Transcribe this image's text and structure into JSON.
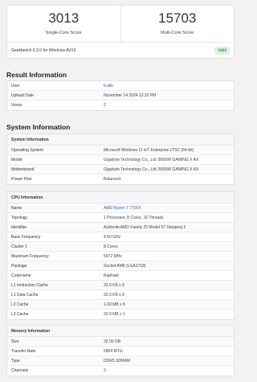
{
  "scores": {
    "single_core": {
      "value": "3013",
      "label": "Single-Core Score"
    },
    "multi_core": {
      "value": "15703",
      "label": "Multi-Core Score"
    },
    "version": "Geekbench 6.3.0 for Windows AVX2",
    "status": "Valid"
  },
  "result_information": {
    "title": "Result Information",
    "rows": [
      {
        "key": "User",
        "value": "Exillic"
      },
      {
        "key": "Upload Date",
        "value": "November 14 2024 12:10 PM"
      },
      {
        "key": "Views",
        "value": "2"
      }
    ]
  },
  "system_information": {
    "title": "System Information",
    "system": {
      "heading": "System Information",
      "rows": [
        {
          "key": "Operating System",
          "value": "Microsoft Windows 11 IoT Enterprise LTSC (64-bit)"
        },
        {
          "key": "Model",
          "value": "Gigabyte Technology Co., Ltd. B650M GAMING X AX"
        },
        {
          "key": "Motherboard",
          "value": "Gigabyte Technology Co., Ltd. B650M GAMING X AX"
        },
        {
          "key": "Power Plan",
          "value": "Balanced"
        }
      ]
    },
    "cpu": {
      "heading": "CPU Information",
      "rows": [
        {
          "key": "Name",
          "value": "AMD Ryzen 7 7700X"
        },
        {
          "key": "Topology",
          "value": "1 Processor, 8 Cores, 16 Threads"
        },
        {
          "key": "Identifier",
          "value": "AuthenticAMD Family 25 Model 97 Stepping 2"
        },
        {
          "key": "Base Frequency",
          "value": "4.50 GHz"
        },
        {
          "key": "Cluster 1",
          "value": "8 Cores"
        },
        {
          "key": "Maximum Frequency",
          "value": "5472 MHz"
        },
        {
          "key": "Package",
          "value": "Socket AM5 (LGA1718)"
        },
        {
          "key": "Codename",
          "value": "Raphael"
        },
        {
          "key": "L1 Instruction Cache",
          "value": "32.0 KB x 8"
        },
        {
          "key": "L1 Data Cache",
          "value": "32.0 KB x 8"
        },
        {
          "key": "L2 Cache",
          "value": "1.00 MB x 8"
        },
        {
          "key": "L3 Cache",
          "value": "32.0 MB x 1"
        }
      ]
    },
    "memory": {
      "heading": "Memory Information",
      "rows": [
        {
          "key": "Size",
          "value": "32.00 GB"
        },
        {
          "key": "Transfer Rate",
          "value": "5904 MT/s"
        },
        {
          "key": "Type",
          "value": "DDR5 SDRAM"
        },
        {
          "key": "Channels",
          "value": "2"
        }
      ]
    }
  },
  "colors": {
    "link": "#1a6fb5",
    "valid_bg": "#e3f0e3",
    "valid_text": "#2d6a2d"
  }
}
